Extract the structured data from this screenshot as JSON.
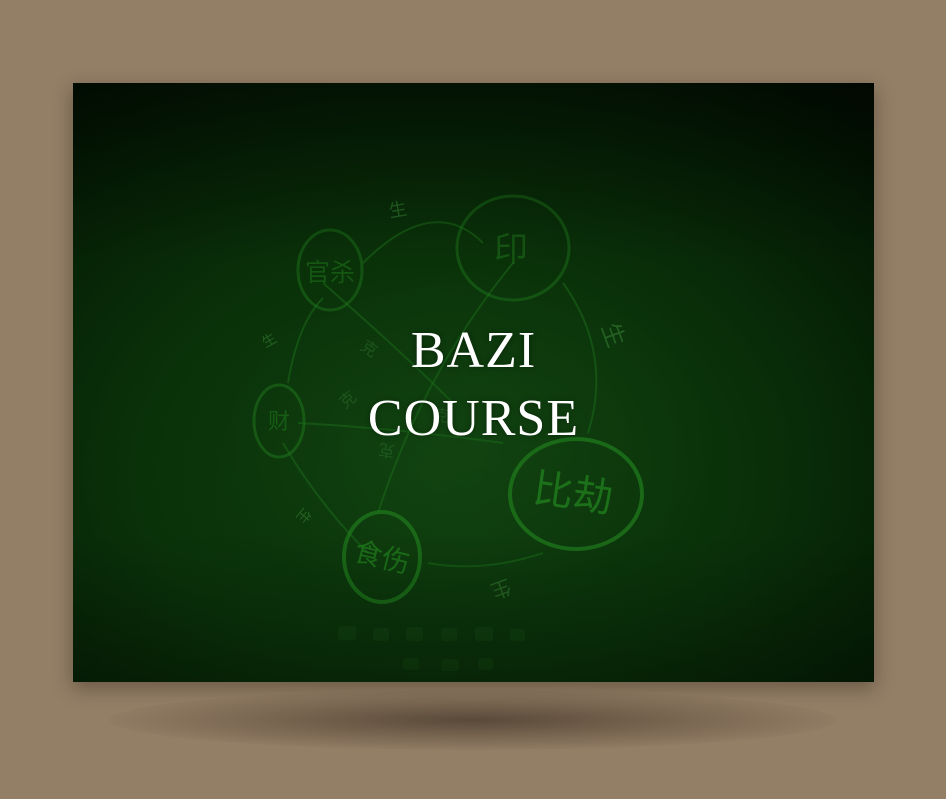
{
  "title": {
    "line1": "BAZI",
    "line2": "COURSE"
  },
  "nodes": {
    "yin": "印",
    "guansha": "官杀",
    "cai": "财",
    "shishang": "食伤",
    "bijie": "比劫"
  },
  "relations": {
    "sheng": "生",
    "ke": "克"
  },
  "colors": {
    "background": "#937e66",
    "card_dark": "#021102",
    "card_mid": "#0f4010",
    "ink": "#1f7a1c",
    "title": "#ffffff"
  }
}
